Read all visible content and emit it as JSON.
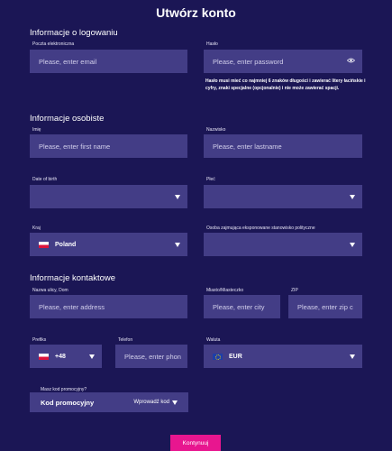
{
  "title": "Utwórz konto",
  "login": {
    "heading": "Informacje o logowaniu",
    "email": {
      "label": "Poczta elektroniczna",
      "placeholder": "Please, enter email"
    },
    "password": {
      "label": "Hasło",
      "placeholder": "Please, enter password",
      "icon": "eye-icon",
      "hint": "Hasło musi mieć co najmniej 6 znaków długości i zawierać litery łacińskie i cyfry, znaki specjalne (opcjonalnie) i nie może zawierać spacji."
    }
  },
  "personal": {
    "heading": "Informacje osobiste",
    "first_name": {
      "label": "Imię",
      "placeholder": "Please, enter first name"
    },
    "last_name": {
      "label": "Nazwisko",
      "placeholder": "Please, enter lastname"
    },
    "dob": {
      "label": "Date of birth",
      "value": ""
    },
    "gender": {
      "label": "Płeć",
      "value": ""
    },
    "country": {
      "label": "Kraj",
      "value": "Poland",
      "flag": "poland-flag-icon"
    },
    "pep": {
      "label": "Osoba zajmująca eksponowane stanowisko polityczne",
      "value": ""
    }
  },
  "contact": {
    "heading": "Informacje kontaktowe",
    "address": {
      "label": "Nazwa ulicy, Dom",
      "placeholder": "Please, enter address"
    },
    "city": {
      "label": "Miasto/Miasteczko",
      "placeholder": "Please, enter city"
    },
    "zip": {
      "label": "ZIP",
      "placeholder": "Please, enter zip c"
    },
    "prefix": {
      "label": "Prefiks",
      "value": "+48",
      "flag": "poland-flag-icon"
    },
    "phone": {
      "label": "Telefon",
      "placeholder": "Please, enter phon"
    },
    "currency": {
      "label": "Waluta",
      "value": "EUR",
      "flag": "eu-flag-icon"
    }
  },
  "promo": {
    "question": "Masz kod promocyjny?",
    "label": "Kod promocyjny",
    "action": "Wprowadź kod"
  },
  "submit_label": "Kontynuuj",
  "colors": {
    "background": "#1b1655",
    "field": "#433d86",
    "accent": "#e8168f"
  }
}
